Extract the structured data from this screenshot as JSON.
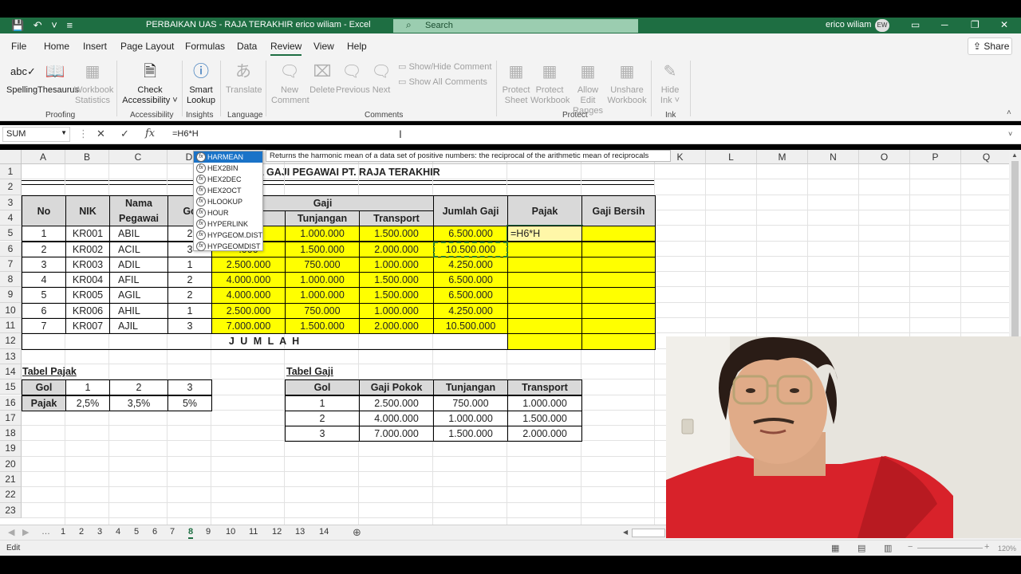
{
  "window": {
    "title": "PERBAIKAN UAS  -  RAJA TERAKHIR erico wiliam  -  Excel",
    "search_placeholder": "Search",
    "user_name": "erico wiliam",
    "user_initials": "EW"
  },
  "menu": {
    "tabs": [
      "File",
      "Home",
      "Insert",
      "Page Layout",
      "Formulas",
      "Data",
      "Review",
      "View",
      "Help"
    ],
    "active": "Review",
    "share_label": "Share"
  },
  "ribbon": {
    "spelling": "Spelling",
    "thesaurus": "Thesaurus",
    "workbook_statistics": [
      "Workbook",
      "Statistics"
    ],
    "check_accessibility": [
      "Check",
      "Accessibility ˅"
    ],
    "smart_lookup": [
      "Smart",
      "Lookup"
    ],
    "translate": "Translate",
    "new_comment": [
      "New",
      "Comment"
    ],
    "delete": "Delete",
    "previous": "Previous",
    "next": "Next",
    "show_hide_comment": "Show/Hide Comment",
    "show_all_comments": "Show All Comments",
    "protect_sheet": [
      "Protect",
      "Sheet"
    ],
    "protect_workbook": [
      "Protect",
      "Workbook"
    ],
    "allow_edit_ranges": [
      "Allow Edit",
      "Ranges"
    ],
    "unshare_workbook": [
      "Unshare",
      "Workbook"
    ],
    "hide_ink": [
      "Hide",
      "Ink ˅"
    ],
    "groups": {
      "proofing": "Proofing",
      "accessibility": "Accessibility",
      "insights": "Insights",
      "language": "Language",
      "comments": "Comments",
      "protect": "Protect",
      "ink": "Ink"
    }
  },
  "formula_bar": {
    "name_box": "SUM",
    "formula": "=H6*H"
  },
  "sheet": {
    "columns": [
      "A",
      "B",
      "C",
      "D",
      "E",
      "F",
      "G",
      "H",
      "I",
      "J",
      "K",
      "L",
      "M",
      "N",
      "O",
      "P",
      "Q"
    ],
    "rows": [
      "1",
      "2",
      "3",
      "4",
      "5",
      "6",
      "7",
      "8",
      "9",
      "10",
      "11",
      "12",
      "13",
      "14",
      "15",
      "16",
      "17",
      "18",
      "19",
      "20",
      "21",
      "22",
      "23"
    ],
    "title": "A GAJI PEGAWAI PT. RAJA TERAKHIR",
    "headers": {
      "no": "No",
      "nik": "NIK",
      "nama": "Nama Pegawai",
      "gol": "Go",
      "gaji": "Gaji",
      "tunjangan": "Tunjangan",
      "transport": "Transport",
      "jumlah_gaji": "Jumlah Gaji",
      "pajak": "Pajak",
      "gaji_bersih": "Gaji Bersih"
    },
    "employees": [
      {
        "no": "1",
        "nik": "KR001",
        "nama": "ABIL",
        "gol": "2",
        "pokok": ".000",
        "tunjangan": "1.000.000",
        "transport": "1.500.000",
        "jumlah": "6.500.000",
        "pajak": "=H6*H"
      },
      {
        "no": "2",
        "nik": "KR002",
        "nama": "ACIL",
        "gol": "3",
        "pokok": ".000",
        "tunjangan": "1.500.000",
        "transport": "2.000.000",
        "jumlah": "10.500.000",
        "pajak": ""
      },
      {
        "no": "3",
        "nik": "KR003",
        "nama": "ADIL",
        "gol": "1",
        "pokok": "2.500.000",
        "tunjangan": "750.000",
        "transport": "1.000.000",
        "jumlah": "4.250.000",
        "pajak": ""
      },
      {
        "no": "4",
        "nik": "KR004",
        "nama": "AFIL",
        "gol": "2",
        "pokok": "4.000.000",
        "tunjangan": "1.000.000",
        "transport": "1.500.000",
        "jumlah": "6.500.000",
        "pajak": ""
      },
      {
        "no": "5",
        "nik": "KR005",
        "nama": "AGIL",
        "gol": "2",
        "pokok": "4.000.000",
        "tunjangan": "1.000.000",
        "transport": "1.500.000",
        "jumlah": "6.500.000",
        "pajak": ""
      },
      {
        "no": "6",
        "nik": "KR006",
        "nama": "AHIL",
        "gol": "1",
        "pokok": "2.500.000",
        "tunjangan": "750.000",
        "transport": "1.000.000",
        "jumlah": "4.250.000",
        "pajak": ""
      },
      {
        "no": "7",
        "nik": "KR007",
        "nama": "AJIL",
        "gol": "3",
        "pokok": "7.000.000",
        "tunjangan": "1.500.000",
        "transport": "2.000.000",
        "jumlah": "10.500.000",
        "pajak": ""
      }
    ],
    "jumlah_label": "J U M L A H",
    "tabel_pajak": {
      "title": "Tabel Pajak",
      "gol_label": "Gol",
      "pajak_label": "Pajak",
      "gol": [
        "1",
        "2",
        "3"
      ],
      "pajak": [
        "2,5%",
        "3,5%",
        "5%"
      ]
    },
    "tabel_gaji": {
      "title": "Tabel Gaji",
      "headers": [
        "Gol",
        "Gaji Pokok",
        "Tunjangan",
        "Transport"
      ],
      "rows": [
        [
          "1",
          "2.500.000",
          "750.000",
          "1.000.000"
        ],
        [
          "2",
          "4.000.000",
          "1.000.000",
          "1.500.000"
        ],
        [
          "3",
          "7.000.000",
          "1.500.000",
          "2.000.000"
        ]
      ]
    }
  },
  "autocomplete": {
    "items": [
      "HARMEAN",
      "HEX2BIN",
      "HEX2DEC",
      "HEX2OCT",
      "HLOOKUP",
      "HOUR",
      "HYPERLINK",
      "HYPGEOM.DIST",
      "HYPGEOMDIST"
    ],
    "selected": "HARMEAN",
    "tooltip": "Returns the harmonic mean of a data set of positive numbers: the reciprocal of the arithmetic mean of reciprocals"
  },
  "sheet_tabs": [
    "1",
    "2",
    "3",
    "4",
    "5",
    "6",
    "7",
    "8",
    "9",
    "10",
    "11",
    "12",
    "13",
    "14"
  ],
  "active_sheet": "8",
  "status": {
    "mode": "Edit",
    "zoom": "120%"
  },
  "colors": {
    "excel_green": "#1e6e42",
    "highlight_yellow": "#ffff00",
    "header_gray": "#d9d9d9",
    "autocomplete_select": "#1a73c8"
  }
}
